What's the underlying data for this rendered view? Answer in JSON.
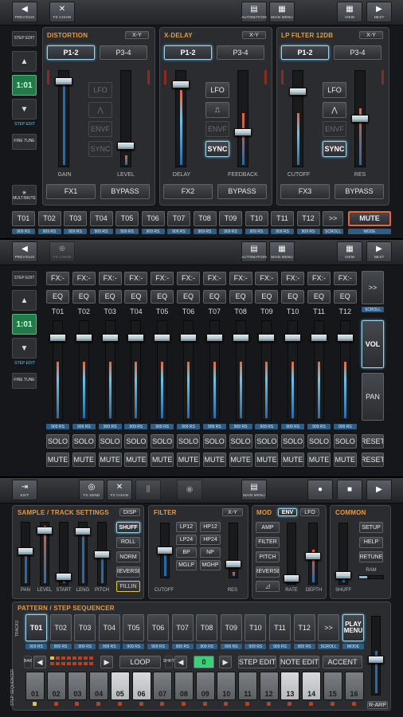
{
  "colors": {
    "accent": "#6ec3e6",
    "title_orange": "#e89a3d",
    "level_red": "#e8643c",
    "tag_blue": "#2e5d86",
    "step_green": "#237a48"
  },
  "nav1": {
    "items": [
      {
        "label": "PREVIOUS",
        "icon": "◀"
      },
      {
        "label": "FX CHAIN",
        "icon": "✕"
      },
      {
        "label": "AUTOMATION",
        "icon": "▤"
      },
      {
        "label": "MAIN MENU",
        "icon": "▦"
      },
      {
        "label": "VIEW",
        "icon": "▦"
      },
      {
        "label": "NEXT",
        "icon": "▶"
      }
    ]
  },
  "nav2": {
    "items": [
      {
        "label": "PREVIOUS",
        "icon": "◀"
      },
      {
        "label": "FX CHAIN",
        "icon": "⊕"
      },
      {
        "label": "AUTOMATION",
        "icon": "▤"
      },
      {
        "label": "MAIN MENU",
        "icon": "▦"
      },
      {
        "label": "VIEW",
        "icon": "▦"
      },
      {
        "label": "NEXT",
        "icon": "▶"
      }
    ]
  },
  "nav3": {
    "items": [
      {
        "label": "EXIT",
        "icon": "⇥"
      },
      {
        "label": "FX SEND",
        "icon": "◎"
      },
      {
        "label": "FX CHAIN",
        "icon": "✕"
      },
      {
        "label": "",
        "icon": "⫼"
      },
      {
        "label": "",
        "icon": "◉"
      },
      {
        "label": "MAIN MENU",
        "icon": "▤"
      },
      {
        "label": "",
        "icon": "●"
      },
      {
        "label": "",
        "icon": "■"
      },
      {
        "label": "",
        "icon": "▶"
      }
    ]
  },
  "left": {
    "step_edit": "STEP EDIT",
    "step_value": "1:01",
    "step_edit_caption": "STEP EDIT",
    "fine_tune": "FINE TUNE",
    "multimute": "MULTIMUTE"
  },
  "fx": [
    {
      "title": "DISTORTION",
      "xy": "X-Y",
      "pages": [
        "P1-2",
        "P3-4"
      ],
      "fader_labels": [
        "GAIN",
        "LEVEL"
      ],
      "mods": [
        "LFO",
        "⋀",
        "ENVF",
        "SYNC"
      ],
      "bottom": [
        "FX1",
        "BYPASS"
      ]
    },
    {
      "title": "X-DELAY",
      "xy": "X-Y",
      "pages": [
        "P1-2",
        "P3-4"
      ],
      "fader_labels": [
        "DELAY",
        "FEEDBACK"
      ],
      "mods": [
        "LFO",
        "⎍",
        "ENVF",
        "SYNC"
      ],
      "bottom": [
        "FX2",
        "BYPASS"
      ]
    },
    {
      "title": "LP FILTER 12DB",
      "xy": "X-Y",
      "pages": [
        "P1-2",
        "P3-4"
      ],
      "fader_labels": [
        "CUTOFF",
        "RES"
      ],
      "mods": [
        "LFO",
        "⋀",
        "ENVF",
        "SYNC"
      ],
      "bottom": [
        "FX3",
        "BYPASS"
      ]
    }
  ],
  "tracks": [
    "T01",
    "T02",
    "T03",
    "T04",
    "T05",
    "T06",
    "T07",
    "T08",
    "T09",
    "T10",
    "T11",
    "T12"
  ],
  "track_tag": "909 RS",
  "track_row": {
    "more": ">>",
    "mute": "MUTE",
    "scroll": "SCROLL",
    "mode": "MODE"
  },
  "mixer": {
    "fx": "FX:-",
    "eq": "EQ",
    "solo": "SOLO",
    "mute": "MUTE",
    "reset": "RESET",
    "more": ">>",
    "scroll": "SCROLL",
    "vol": "VOL",
    "pan": "PAN",
    "levels": [
      0.58,
      0.58,
      0.58,
      0.58,
      0.58,
      0.58,
      0.58,
      0.58,
      0.58,
      0.58,
      0.58,
      0.58
    ]
  },
  "sample": {
    "title": "SAMPLE / TRACK SETTINGS",
    "disp": "DISP",
    "faders": [
      "PAN",
      "LEVEL",
      "START",
      "LENG",
      "PITCH"
    ],
    "buttons": [
      "SHUFF",
      "ROLL",
      "NORM",
      "REVERSE",
      "FILLIN"
    ]
  },
  "filter": {
    "title": "FILTER",
    "xy": "X-Y",
    "buttons": [
      "LP12",
      "HP12",
      "LP24",
      "HP24",
      "BP",
      "NP",
      "MGLP",
      "MGHP"
    ],
    "cutoff": "CUTOFF",
    "res": "RES"
  },
  "mod": {
    "title": "MOD",
    "tab1": "ENV",
    "tab2": "LFO",
    "buttons": [
      "AMP",
      "FILTER",
      "PITCH",
      "REVERSE"
    ],
    "rate": "RATE",
    "depth": "DEPTH"
  },
  "common": {
    "title": "COMMON",
    "buttons": [
      "SETUP",
      "HELP",
      "RETUNE"
    ],
    "ram": "RAM",
    "shuff": "SHUFF"
  },
  "seq": {
    "title": "PATTERN / STEP SEQUENCER",
    "tracks_label": "TRACKS",
    "bar_label": "BAR",
    "shift_label": "SHIFT",
    "step_seq_label": "STEP SEQUENCER",
    "loop": "LOOP",
    "shift_value": "0",
    "step_edit": "STEP EDIT",
    "note_edit": "NOTE EDIT",
    "accent": "ACCENT",
    "play_menu": "PLAY MENU",
    "mode": "MODE",
    "scroll": "SCROLL",
    "more": ">>",
    "r_arp": "R-ARP",
    "steps": [
      "01",
      "02",
      "03",
      "04",
      "05",
      "06",
      "07",
      "08",
      "09",
      "10",
      "11",
      "12",
      "13",
      "14",
      "15",
      "16"
    ],
    "light_steps": [
      5,
      6,
      13,
      14
    ]
  }
}
